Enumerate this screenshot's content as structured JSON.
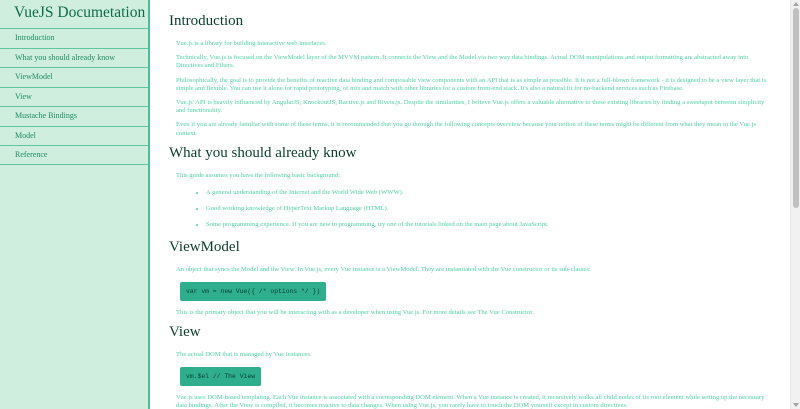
{
  "sidebar": {
    "brand": "VueJS Documetation",
    "items": [
      {
        "label": "Introduction"
      },
      {
        "label": "What you should already know"
      },
      {
        "label": "ViewModel"
      },
      {
        "label": "View"
      },
      {
        "label": "Mustache Bindings"
      },
      {
        "label": "Model"
      },
      {
        "label": "Reference"
      }
    ]
  },
  "main": {
    "introduction": {
      "title": "Introduction",
      "paragraphs": [
        "Vue.js is a library for building interactive web interfaces.",
        "Technically, Vue.js is focused on the ViewModel layer of the MVVM pattern. It connects the View and the Model via two way data bindings. Actual DOM manipulations and output formatting are abstracted away into Directives and Filters.",
        "Philosophically, the goal is to provide the benefits of reactive data binding and composable view components with an API that is as simple as possible. It is not a full-blown framework - it is designed to be a view layer that is simple and flexible. You can use it alone for rapid prototyping, or mix and match with other libraries for a custom front-end stack. It's also a natural fit for no-backend services such as Firebase.",
        "Vue.js' API is heavily influenced by AngularJS, KnockoutJS, Ractive.js and Rivets.js. Despite the similarities, I believe Vue.js offers a valuable alternative to these existing libraries by finding a sweetspot between simplicity and functionality.",
        "Even if you are already familiar with some of these terms, it is recommended that you go through the following concepts overview because your notion of these terms might be different from what they mean in the Vue.js context."
      ]
    },
    "already_know": {
      "title": "What you should already know",
      "intro": "This guide assumes you have the following basic background:",
      "bullets": [
        "A general understanding of the Internet and the World Wide Web (WWW).",
        "Good working knowledge of HyperText Markup Language (HTML).",
        "Some programming experience. If you are new to programming, try one of the tutorials linked on the main page about JavaScript."
      ]
    },
    "viewmodel": {
      "title": "ViewModel",
      "p1": "An object that syncs the Model and the View. In Vue.js, every Vue instance is a ViewModel. They are instantiated with the Vue constructor or its sub-classes:",
      "code": "var vm = new Vue({ /* options */ })",
      "p2": "This is the primary object that you will be interacting with as a developer when using Vue.js. For more details see The Vue Constructor."
    },
    "view": {
      "title": "View",
      "p1": "The actual DOM that is managed by Vue instances.",
      "code": "vm.$el // The View",
      "p2": "Vue.js uses DOM-based templating. Each Vue instance is associated with a corresponding DOM element. When a Vue instance is created, it recursively walks all child nodes of its root element while setting up the necessary data bindings. After the View is compiled, it becomes reactive to data changes. When using Vue.js, you rarely have to touch the DOM yourself except in custom directives."
    }
  }
}
